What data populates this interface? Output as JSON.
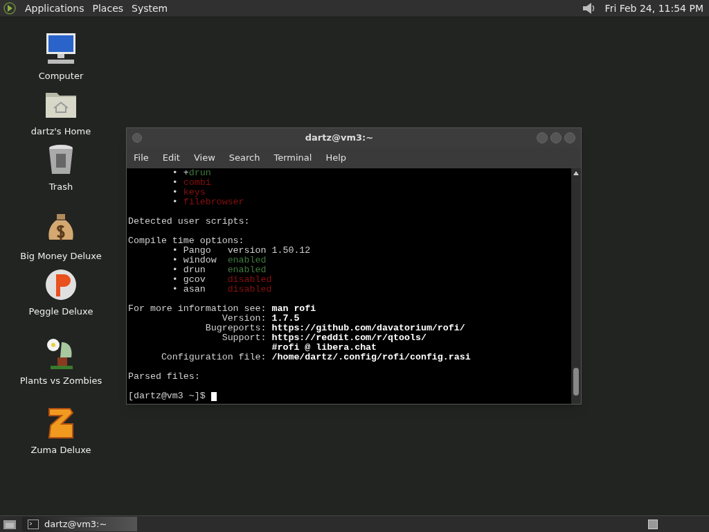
{
  "top_panel": {
    "menus": [
      "Applications",
      "Places",
      "System"
    ],
    "clock": "Fri Feb 24, 11:54 PM"
  },
  "desktop_icons": [
    {
      "kind": "computer",
      "label": "Computer"
    },
    {
      "kind": "home",
      "label": "dartz's Home"
    },
    {
      "kind": "trash",
      "label": "Trash"
    },
    {
      "kind": "money",
      "label": "Big Money Deluxe"
    },
    {
      "kind": "peggle",
      "label": "Peggle Deluxe"
    },
    {
      "kind": "plants",
      "label": "Plants vs Zombies"
    },
    {
      "kind": "zuma",
      "label": "Zuma Deluxe"
    }
  ],
  "window": {
    "title": "dartz@vm3:~",
    "menu": [
      "File",
      "Edit",
      "View",
      "Search",
      "Terminal",
      "Help"
    ],
    "terminal_blocks": [
      [
        [
          {
            "kind": "plain",
            "text": "        • +"
          },
          {
            "kind": "green",
            "text": "drun"
          }
        ],
        [
          {
            "kind": "plain",
            "text": "        • "
          },
          {
            "kind": "red",
            "text": "combi"
          }
        ],
        [
          {
            "kind": "plain",
            "text": "        • "
          },
          {
            "kind": "red",
            "text": "keys"
          }
        ],
        [
          {
            "kind": "plain",
            "text": "        • "
          },
          {
            "kind": "red",
            "text": "filebrowser"
          }
        ]
      ],
      [
        [
          {
            "kind": "plain",
            "text": "Detected user scripts:"
          }
        ]
      ],
      [
        [
          {
            "kind": "plain",
            "text": "Compile time options:"
          }
        ],
        [
          {
            "kind": "plain",
            "text": "        • Pango   version 1.50.12"
          }
        ],
        [
          {
            "kind": "plain",
            "text": "        • window  "
          },
          {
            "kind": "green",
            "text": "enabled"
          }
        ],
        [
          {
            "kind": "plain",
            "text": "        • drun    "
          },
          {
            "kind": "green",
            "text": "enabled"
          }
        ],
        [
          {
            "kind": "plain",
            "text": "        • gcov    "
          },
          {
            "kind": "red",
            "text": "disabled"
          }
        ],
        [
          {
            "kind": "plain",
            "text": "        • asan    "
          },
          {
            "kind": "red",
            "text": "disabled"
          }
        ]
      ],
      [
        [
          {
            "kind": "plain",
            "text": "For more information see: "
          },
          {
            "kind": "bold",
            "text": "man rofi"
          }
        ],
        [
          {
            "kind": "plain",
            "text": "                 Version: "
          },
          {
            "kind": "bold",
            "text": "1.7.5"
          }
        ],
        [
          {
            "kind": "plain",
            "text": "              Bugreports: "
          },
          {
            "kind": "bold",
            "text": "https://github.com/davatorium/rofi/"
          }
        ],
        [
          {
            "kind": "plain",
            "text": "                 Support: "
          },
          {
            "kind": "bold",
            "text": "https://reddit.com/r/qtools/"
          }
        ],
        [
          {
            "kind": "bold",
            "text": "                          #rofi @ libera.chat"
          }
        ],
        [
          {
            "kind": "plain",
            "text": "      Configuration file: "
          },
          {
            "kind": "bold",
            "text": "/home/dartz/.config/rofi/config.rasi"
          }
        ]
      ],
      [
        [
          {
            "kind": "plain",
            "text": "Parsed files:"
          }
        ]
      ],
      [
        [
          {
            "kind": "plain",
            "text": "[dartz@vm3 ~]$ "
          }
        ]
      ]
    ]
  },
  "taskbar": {
    "tasks": [
      {
        "label": "dartz@vm3:~",
        "selected": true
      }
    ]
  }
}
